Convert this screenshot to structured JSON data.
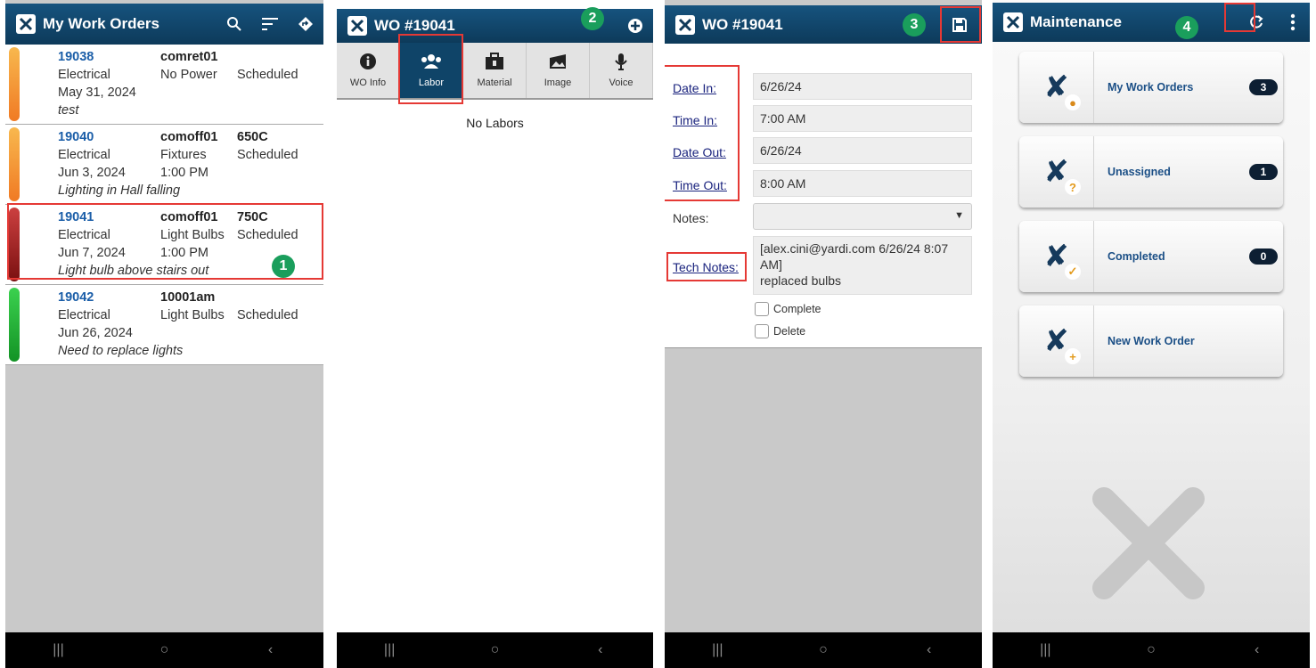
{
  "screen1": {
    "title": "My Work Orders",
    "icons": [
      "search-icon",
      "sort-icon",
      "navigate-icon"
    ],
    "items": [
      {
        "id": "19038",
        "category": "Electrical",
        "date": "May 31, 2024",
        "note": "test",
        "user": "comret01",
        "issue": "No Power",
        "time": "",
        "code": "",
        "status": "Scheduled",
        "color": "#f39a33"
      },
      {
        "id": "19040",
        "category": "Electrical",
        "date": "Jun 3, 2024",
        "note": "Lighting in Hall falling",
        "user": "comoff01",
        "issue": "Fixtures",
        "time": "1:00 PM",
        "code": "650C",
        "status": "Scheduled",
        "color": "#f39a33"
      },
      {
        "id": "19041",
        "category": "Electrical",
        "date": "Jun 7, 2024",
        "note": "Light bulb above stairs out",
        "user": "comoff01",
        "issue": "Light Bulbs",
        "time": "1:00 PM",
        "code": "750C",
        "status": "Scheduled",
        "color": "#b02a2a"
      },
      {
        "id": "19042",
        "category": "Electrical",
        "date": "Jun 26, 2024",
        "note": "Need to replace lights",
        "user": "10001am",
        "issue": "Light Bulbs",
        "time": "",
        "code": "",
        "status": "Scheduled",
        "color": "#27b23a"
      }
    ],
    "badge": "1"
  },
  "screen2": {
    "title": "WO #19041",
    "badge": "2",
    "tabs": [
      {
        "label": "WO Info",
        "icon": "info-icon"
      },
      {
        "label": "Labor",
        "icon": "people-icon"
      },
      {
        "label": "Material",
        "icon": "toolbox-icon"
      },
      {
        "label": "Image",
        "icon": "image-icon"
      },
      {
        "label": "Voice",
        "icon": "microphone-icon"
      }
    ],
    "empty_text": "No Labors"
  },
  "screen3": {
    "title": "WO #19041",
    "badge": "3",
    "fields": {
      "date_in_label": "Date In:",
      "date_in": "6/26/24",
      "time_in_label": "Time In:",
      "time_in": "7:00 AM",
      "date_out_label": "Date Out:",
      "date_out": "6/26/24",
      "time_out_label": "Time Out:",
      "time_out": "8:00 AM",
      "notes_label": "Notes:",
      "tech_notes_label": "Tech Notes:",
      "tech_notes_line1": "[alex.cini@yardi.com 6/26/24 8:07",
      "tech_notes_line2": "AM]",
      "tech_notes_line3": "replaced bulbs",
      "complete_label": "Complete",
      "delete_label": "Delete"
    }
  },
  "screen4": {
    "title": "Maintenance",
    "badge": "4",
    "tiles": [
      {
        "label": "My Work Orders",
        "count": "3",
        "sub": "person"
      },
      {
        "label": "Unassigned",
        "count": "1",
        "sub": "?"
      },
      {
        "label": "Completed",
        "count": "0",
        "sub": "✓"
      },
      {
        "label": "New Work Order",
        "count": "",
        "sub": "+"
      }
    ]
  }
}
